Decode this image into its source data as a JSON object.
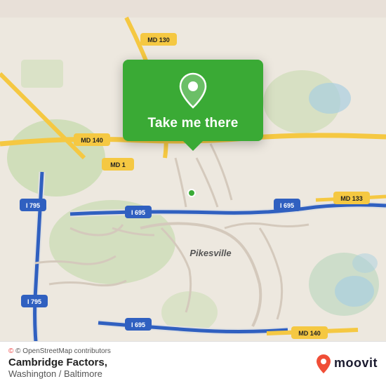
{
  "map": {
    "background_color": "#ede8df",
    "accent_green": "#3aaa35"
  },
  "popup": {
    "button_label": "Take me there",
    "icon_name": "location-pin-icon"
  },
  "bottom_bar": {
    "attribution": "© OpenStreetMap contributors",
    "location_name": "Cambridge Factors,",
    "location_region": "Washington / Baltimore",
    "brand": "moovit"
  }
}
